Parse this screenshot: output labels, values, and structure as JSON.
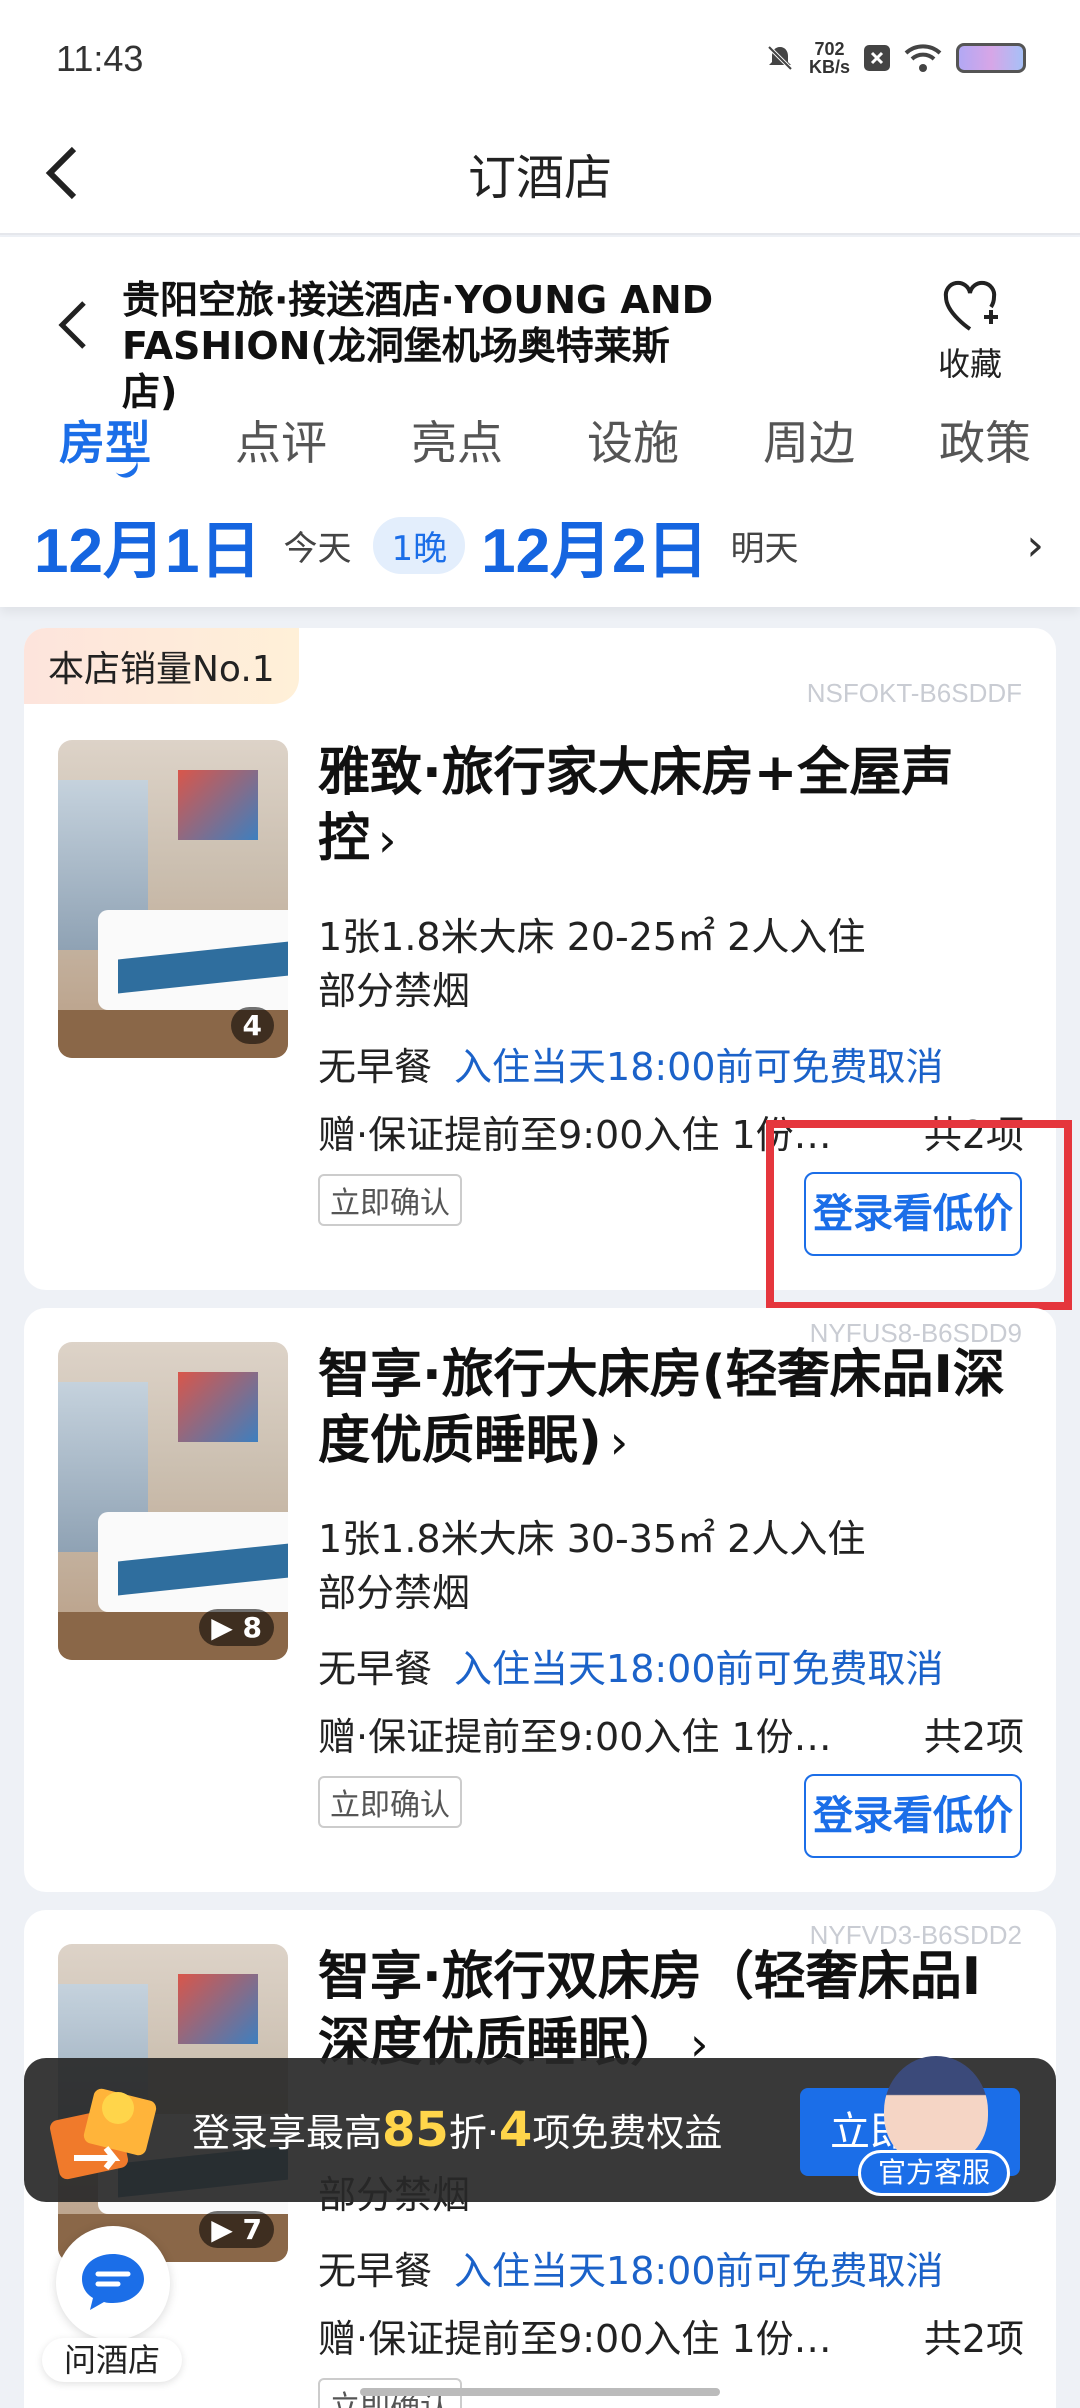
{
  "status": {
    "time": "11:43",
    "speed_value": "702",
    "speed_unit": "KB/s"
  },
  "nav": {
    "title": "订酒店"
  },
  "hotel": {
    "name": "贵阳空旅·接送酒店·YOUNG AND FASHION(龙洞堡机场奥特莱斯店)",
    "favorite_label": "收藏"
  },
  "tabs": [
    "房型",
    "点评",
    "亮点",
    "设施",
    "周边",
    "政策"
  ],
  "dates": {
    "checkin": "12月1日",
    "checkin_label": "今天",
    "nights": "1晚",
    "checkout": "12月2日",
    "checkout_label": "明天"
  },
  "rooms": [
    {
      "badge": "本店销量No.1",
      "code": "NSFOKT-B6SDDF",
      "title": "雅致·旅行家大床房+全屋声控",
      "photos": "4",
      "spec": "1张1.8米大床 20-25㎡ 2人入住",
      "smoking": "部分禁烟",
      "breakfast": "无早餐",
      "cancel": "入住当天18:00前可免费取消",
      "gift": "赠·保证提前至9:00入住 1份…",
      "gift_count": "共2项",
      "confirm": "立即确认",
      "price_btn": "登录看低价"
    },
    {
      "code": "NYFUS8-B6SDD9",
      "title": "智享·旅行大床房(轻奢床品I深度优质睡眠)",
      "photos": "8",
      "spec": "1张1.8米大床 30-35㎡ 2人入住",
      "smoking": "部分禁烟",
      "breakfast": "无早餐",
      "cancel": "入住当天18:00前可免费取消",
      "gift": "赠·保证提前至9:00入住 1份…",
      "gift_count": "共2项",
      "confirm": "立即确认",
      "price_btn": "登录看低价"
    },
    {
      "code": "NYFVD3-B6SDD2",
      "title": "智享·旅行双床房（轻奢床品I深度优质睡眠）",
      "photos": "7",
      "smoking": "部分禁烟",
      "breakfast": "无早餐",
      "cancel": "入住当天18:00前可免费取消",
      "gift": "赠·保证提前至9:00入住 1份…",
      "gift_count": "共2项",
      "confirm": "立即确认"
    }
  ],
  "promo": {
    "text_prefix": "登录享最高",
    "discount": "85",
    "text_mid": "折·",
    "benefits": "4",
    "text_suffix": "项免费权益",
    "button": "立即"
  },
  "service": {
    "label": "官方客服"
  },
  "ask": {
    "label": "问酒店"
  }
}
